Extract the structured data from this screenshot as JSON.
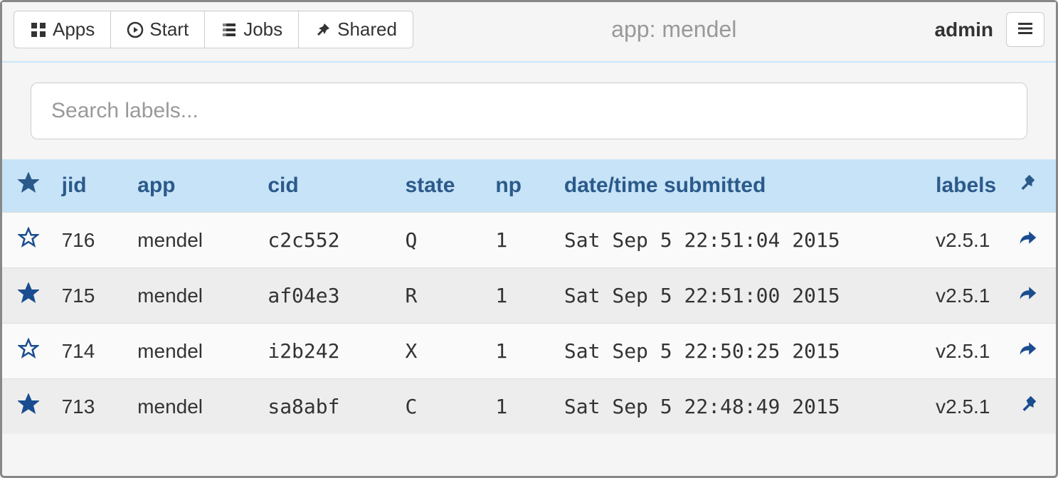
{
  "nav": {
    "apps": "Apps",
    "start": "Start",
    "jobs": "Jobs",
    "shared": "Shared"
  },
  "header": {
    "title": "app: mendel",
    "user": "admin"
  },
  "search": {
    "placeholder": "Search labels..."
  },
  "columns": {
    "jid": "jid",
    "app": "app",
    "cid": "cid",
    "state": "state",
    "np": "np",
    "date": "date/time submitted",
    "labels": "labels"
  },
  "rows": [
    {
      "starred": false,
      "jid": "716",
      "app": "mendel",
      "cid": "c2c552",
      "state": "Q",
      "np": "1",
      "date": "Sat Sep 5 22:51:04 2015",
      "labels": "v2.5.1",
      "action": "share"
    },
    {
      "starred": true,
      "jid": "715",
      "app": "mendel",
      "cid": "af04e3",
      "state": "R",
      "np": "1",
      "date": "Sat Sep 5 22:51:00 2015",
      "labels": "v2.5.1",
      "action": "share"
    },
    {
      "starred": false,
      "jid": "714",
      "app": "mendel",
      "cid": "i2b242",
      "state": "X",
      "np": "1",
      "date": "Sat Sep 5 22:50:25 2015",
      "labels": "v2.5.1",
      "action": "share"
    },
    {
      "starred": true,
      "jid": "713",
      "app": "mendel",
      "cid": "sa8abf",
      "state": "C",
      "np": "1",
      "date": "Sat Sep 5 22:48:49 2015",
      "labels": "v2.5.1",
      "action": "pin"
    }
  ]
}
